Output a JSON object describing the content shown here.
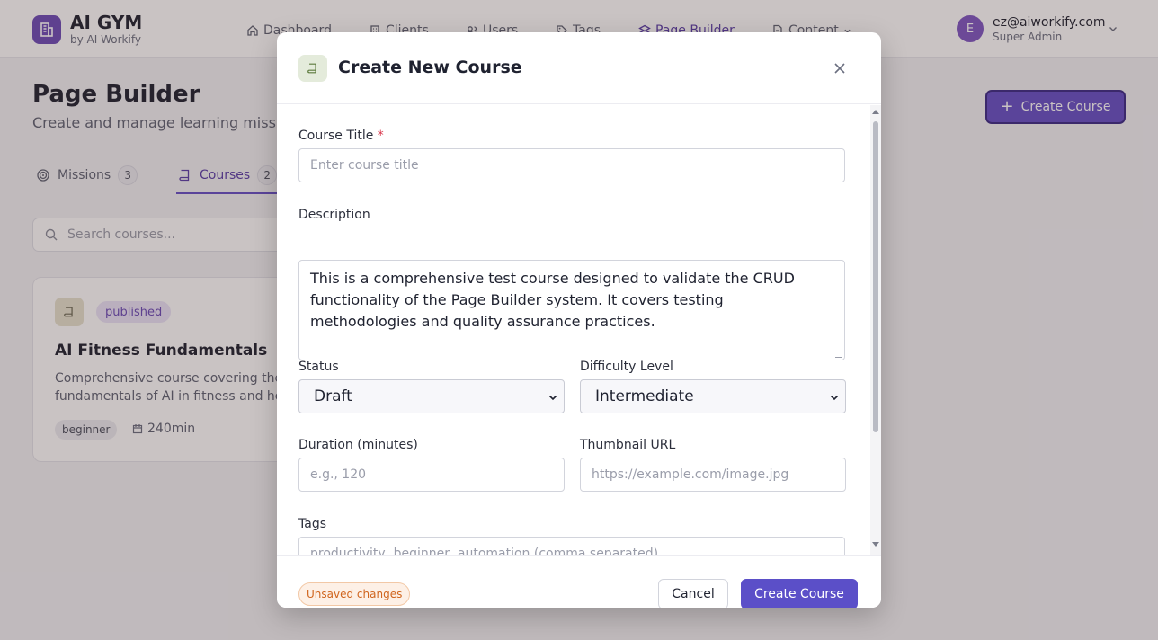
{
  "app": {
    "title": "AI GYM",
    "subtitle": "by AI Workify"
  },
  "nav": {
    "items": [
      {
        "label": "Dashboard",
        "icon": "home-icon"
      },
      {
        "label": "Clients",
        "icon": "building-icon"
      },
      {
        "label": "Users",
        "icon": "users-icon"
      },
      {
        "label": "Tags",
        "icon": "tag-icon"
      },
      {
        "label": "Page Builder",
        "icon": "layers-icon",
        "active": true
      },
      {
        "label": "Content",
        "icon": "document-icon"
      }
    ]
  },
  "user": {
    "initial": "E",
    "email": "ez@aiworkify.com",
    "role": "Super Admin"
  },
  "page": {
    "title": "Page Builder",
    "subtitle": "Create and manage learning miss",
    "create_button": "Create Course"
  },
  "tabs": [
    {
      "label": "Missions",
      "count": "3"
    },
    {
      "label": "Courses",
      "count": "2",
      "active": true
    }
  ],
  "search": {
    "placeholder": "Search courses..."
  },
  "course_card": {
    "status": "published",
    "title": "AI Fitness Fundamentals",
    "description_line1": "Comprehensive course covering the",
    "description_line2": "fundamentals of AI in fitness and he",
    "level": "beginner",
    "duration": "240min"
  },
  "modal": {
    "title": "Create New Course",
    "fields": {
      "course_title": {
        "label": "Course Title",
        "required_mark": "*",
        "placeholder": "Enter course title",
        "value": ""
      },
      "description": {
        "label": "Description",
        "value": "This is a comprehensive test course designed to validate the CRUD functionality of the Page Builder system. It covers testing methodologies and quality assurance practices."
      },
      "status": {
        "label": "Status",
        "value": "Draft"
      },
      "difficulty": {
        "label": "Difficulty Level",
        "value": "Intermediate"
      },
      "duration": {
        "label": "Duration (minutes)",
        "placeholder": "e.g., 120"
      },
      "thumbnail": {
        "label": "Thumbnail URL",
        "placeholder": "https://example.com/image.jpg"
      },
      "tags": {
        "label": "Tags",
        "placeholder": "productivity, beginner, automation (comma separated)"
      }
    },
    "footer": {
      "unsaved": "Unsaved changes",
      "cancel": "Cancel",
      "submit": "Create Course"
    }
  },
  "colors": {
    "accent": "#6650c6",
    "brand": "#6d4bb8",
    "warning": "#d0651e"
  }
}
